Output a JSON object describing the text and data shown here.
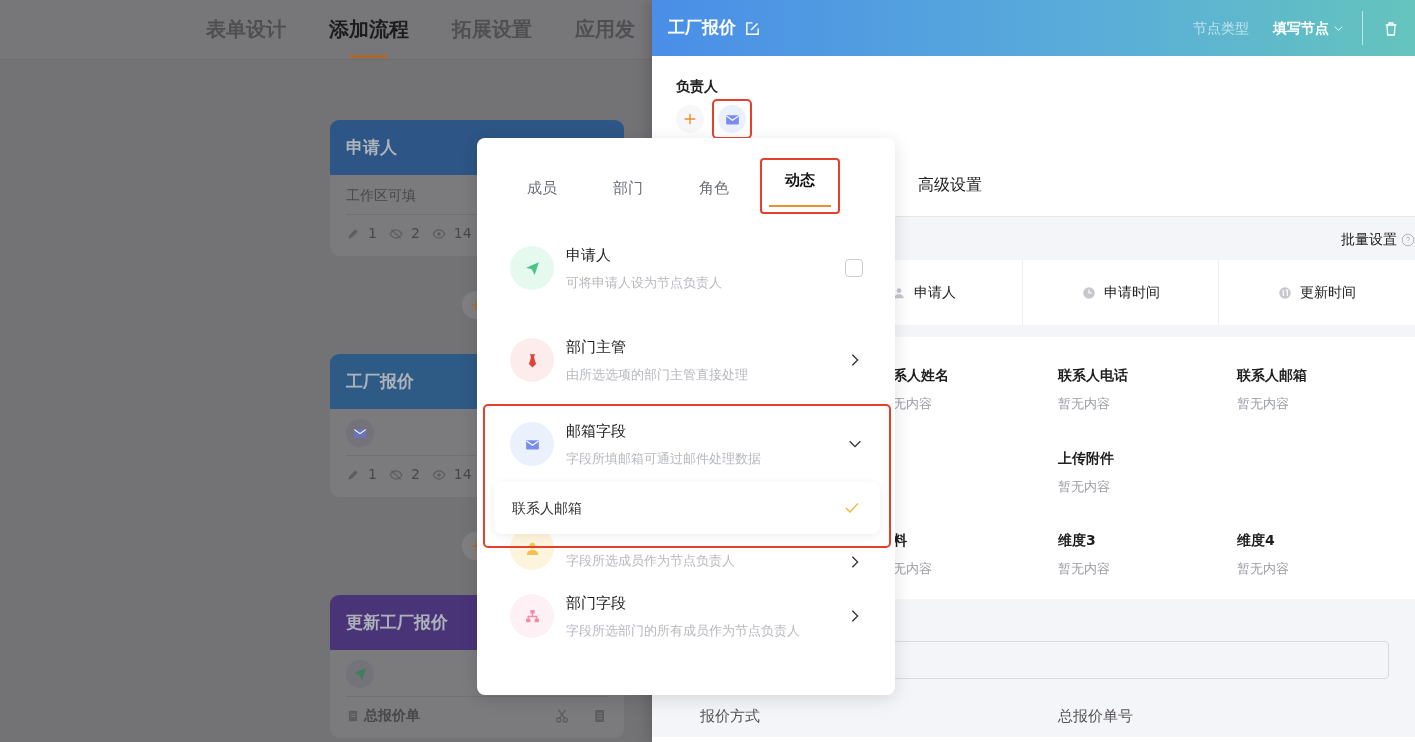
{
  "top_tabs": [
    {
      "label": "表单设计",
      "selected": false
    },
    {
      "label": "添加流程",
      "selected": true
    },
    {
      "label": "拓展设置",
      "selected": false
    },
    {
      "label": "应用发",
      "selected": false
    }
  ],
  "flow_nodes": [
    {
      "title": "申请人",
      "color": "#2d5585",
      "kind": "text",
      "body": "工作区可填",
      "stats": [
        "1",
        "2",
        "14"
      ]
    },
    {
      "title": "工厂报价",
      "color": "#2e5a86",
      "kind": "avatar",
      "stats": [
        "1",
        "2",
        "14"
      ]
    },
    {
      "title": "更新工厂报价",
      "color": "#4a3478",
      "kind": "avatar",
      "field": "总报价单"
    }
  ],
  "drawer": {
    "title": "工厂报价",
    "node_type_label": "节点类型",
    "node_type": "填写节点",
    "owner_label": "负责人",
    "owners": [
      {
        "highlighted": true
      }
    ],
    "tabs": [
      {
        "label": "高级设置",
        "selected": false
      }
    ],
    "batch_label": "批量设置",
    "system_fields": [
      {
        "label": "申请人"
      },
      {
        "label": "申请时间"
      },
      {
        "label": "更新时间"
      }
    ],
    "field_rows": [
      [
        {
          "label": "系人姓名",
          "value": "无内容"
        },
        {
          "label": "联系人电话",
          "value": "暂无内容"
        },
        {
          "label": "联系人邮箱",
          "value": "暂无内容"
        }
      ],
      [
        null,
        {
          "label": "上传附件",
          "value": "暂无内容"
        },
        null
      ],
      [
        {
          "label": "料",
          "value": "无内容"
        },
        {
          "label": "维度3",
          "value": "暂无内容"
        },
        {
          "label": "维度4",
          "value": "暂无内容"
        }
      ]
    ],
    "bottom_fields": [
      "报价方式",
      "总报价单号"
    ]
  },
  "popover": {
    "tabs": [
      {
        "label": "成员",
        "selected": false,
        "highlighted": false
      },
      {
        "label": "部门",
        "selected": false,
        "highlighted": false
      },
      {
        "label": "角色",
        "selected": false,
        "highlighted": false
      },
      {
        "label": "动态",
        "selected": true,
        "highlighted": true
      }
    ],
    "options": [
      {
        "kind": "checkbox",
        "title": "申请人",
        "desc": "可将申请人设为节点负责人",
        "checked": false
      },
      {
        "kind": "submenu",
        "title": "部门主管",
        "desc": "由所选选项的部门主管直接处理"
      },
      {
        "kind": "expandable",
        "title": "邮箱字段",
        "desc": "字段所填邮箱可通过邮件处理数据",
        "expanded": true,
        "highlighted": true,
        "choices": [
          {
            "label": "联系人邮箱",
            "selected": true
          }
        ]
      },
      {
        "kind": "submenu",
        "desc": "字段所选成员作为节点负责人"
      },
      {
        "kind": "submenu",
        "title": "部门字段",
        "desc": "字段所选部门的所有成员作为节点负责人"
      }
    ]
  }
}
